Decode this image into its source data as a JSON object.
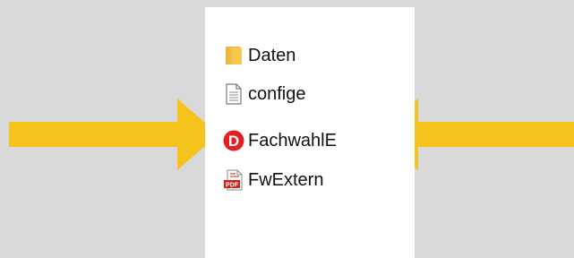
{
  "files": [
    {
      "name": "Daten",
      "icon": "folder-icon"
    },
    {
      "name": "confige",
      "icon": "text-document-icon"
    },
    {
      "name": "FachwahlE",
      "icon": "red-d-logo-icon"
    },
    {
      "name": "FwExtern",
      "icon": "pdf-document-icon"
    }
  ],
  "icons": {
    "d_logo_letter": "D",
    "pdf_badge": "PDF"
  },
  "colors": {
    "background": "#d9d9d9",
    "panel": "#ffffff",
    "arrow": "#f6c21c",
    "folder": "#f8c94c",
    "logo_red": "#e31e24",
    "pdf_red": "#c8231b"
  }
}
